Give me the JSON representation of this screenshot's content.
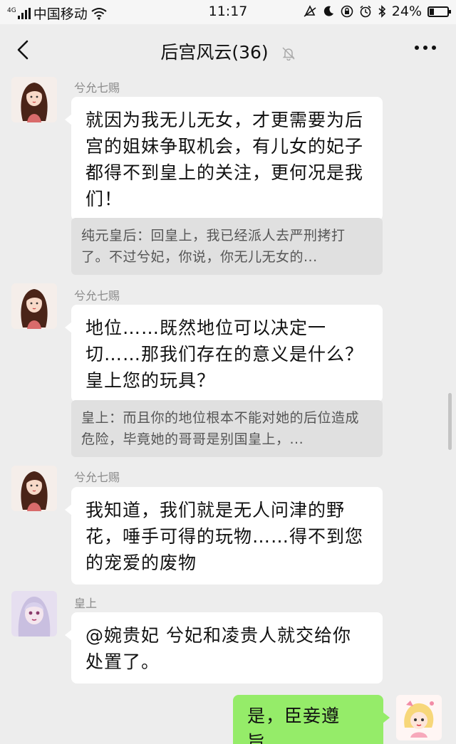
{
  "status_bar": {
    "network_tag": "4G",
    "carrier": "中国移动",
    "time": "11:17",
    "battery_percent": "24%",
    "battery_level": 0.24,
    "icons": [
      "signal-icon",
      "wifi-icon",
      "vibrate-icon",
      "moon-icon",
      "rotation-lock-icon",
      "alarm-icon",
      "bluetooth-icon",
      "battery-icon"
    ]
  },
  "header": {
    "title": "后宫风云(36)",
    "back_icon": "chevron-left-icon",
    "mute_icon": "bell-muted-icon",
    "more_icon": "more-dots-icon"
  },
  "messages": [
    {
      "sender": "兮允七赐",
      "text": "就因为我无儿无女，才更需要为后宫的姐妹争取机会，有儿女的妃子都得不到皇上的关注，更何况是我们！",
      "quote": "纯元皇后：回皇上，我已经派人去严刑拷打了。不过兮妃，你说，你无儿无女的..."
    },
    {
      "sender": "兮允七赐",
      "text": "地位……既然地位可以决定一切……那我们存在的意义是什么？皇上您的玩具？",
      "quote": "皇上：而且你的地位根本不能对她的后位造成危险，毕竟她的哥哥是别国皇上，..."
    },
    {
      "sender": "兮允七赐",
      "text": "我知道，我们就是无人问津的野花，唾手可得的玩物……得不到您的宠爱的废物"
    },
    {
      "sender": "皇上",
      "text": "@婉贵妃  兮妃和凌贵人就交给你处置了。"
    },
    {
      "sender": "",
      "text": "是，臣妾遵旨。",
      "self": true
    }
  ],
  "colors": {
    "background": "#ededed",
    "bubble_incoming": "#ffffff",
    "bubble_outgoing": "#95ec69",
    "quote_background": "#e0e0e0"
  }
}
